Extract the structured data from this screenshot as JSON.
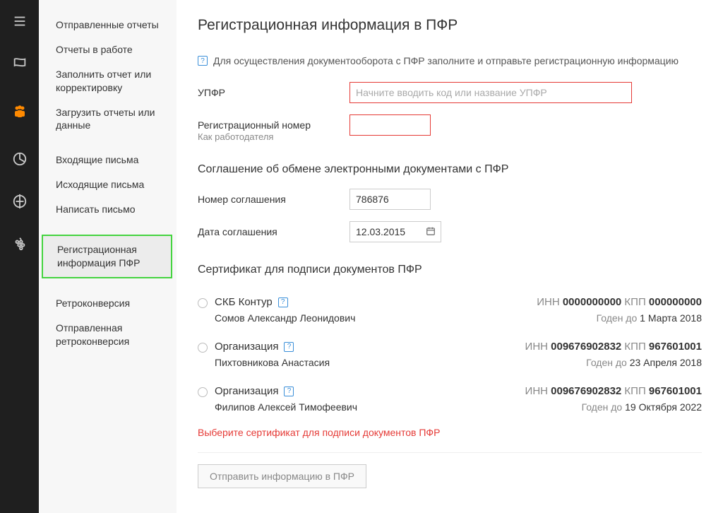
{
  "rail": {
    "activeIndex": 2
  },
  "sidebar": {
    "items": [
      "Отправленные отчеты",
      "Отчеты в работе",
      "Заполнить отчет или корректировку",
      "Загрузить отчеты или данные",
      "Входящие письма",
      "Исходящие письма",
      "Написать письмо",
      "Регистрационная информация ПФР",
      "Ретроконверсия",
      "Отправленная ретроконверсия"
    ]
  },
  "main": {
    "title": "Регистрационная информация в ПФР",
    "infoText": "Для осуществления документооборота с ПФР заполните и отправьте регистрационную информацию",
    "labels": {
      "upfr": "УПФР",
      "upfrPlaceholder": "Начните вводить код или название УПФР",
      "regNum": "Регистрационный номер",
      "regNumSub": "Как работодателя",
      "agreementHeading": "Соглашение об обмене электронными документами с ПФР",
      "agreementNum": "Номер соглашения",
      "agreementDate": "Дата соглашения",
      "certHeading": "Сертификат для подписи документов ПФР",
      "certErr": "Выберите cертификат для подписи документов ПФР",
      "innLabel": "ИНН",
      "kppLabel": "КПП",
      "validLabel": "Годен до",
      "submit": "Отправить информацию в ПФР"
    },
    "values": {
      "upfr": "",
      "regNum": "",
      "agreementNum": "786876",
      "agreementDate": "12.03.2015"
    },
    "certs": [
      {
        "org": "СКБ Контур",
        "person": "Сомов Александр Леонидович",
        "inn": "0000000000",
        "kpp": "000000000",
        "valid": "1 Марта 2018"
      },
      {
        "org": "Организация",
        "person": "Пихтовникова Анастасия",
        "inn": "009676902832",
        "kpp": "967601001",
        "valid": "23 Апреля 2018"
      },
      {
        "org": "Организация",
        "person": "Филипов Алексей Тимофеевич",
        "inn": "009676902832",
        "kpp": "967601001",
        "valid": "19 Октября 2022"
      }
    ]
  }
}
